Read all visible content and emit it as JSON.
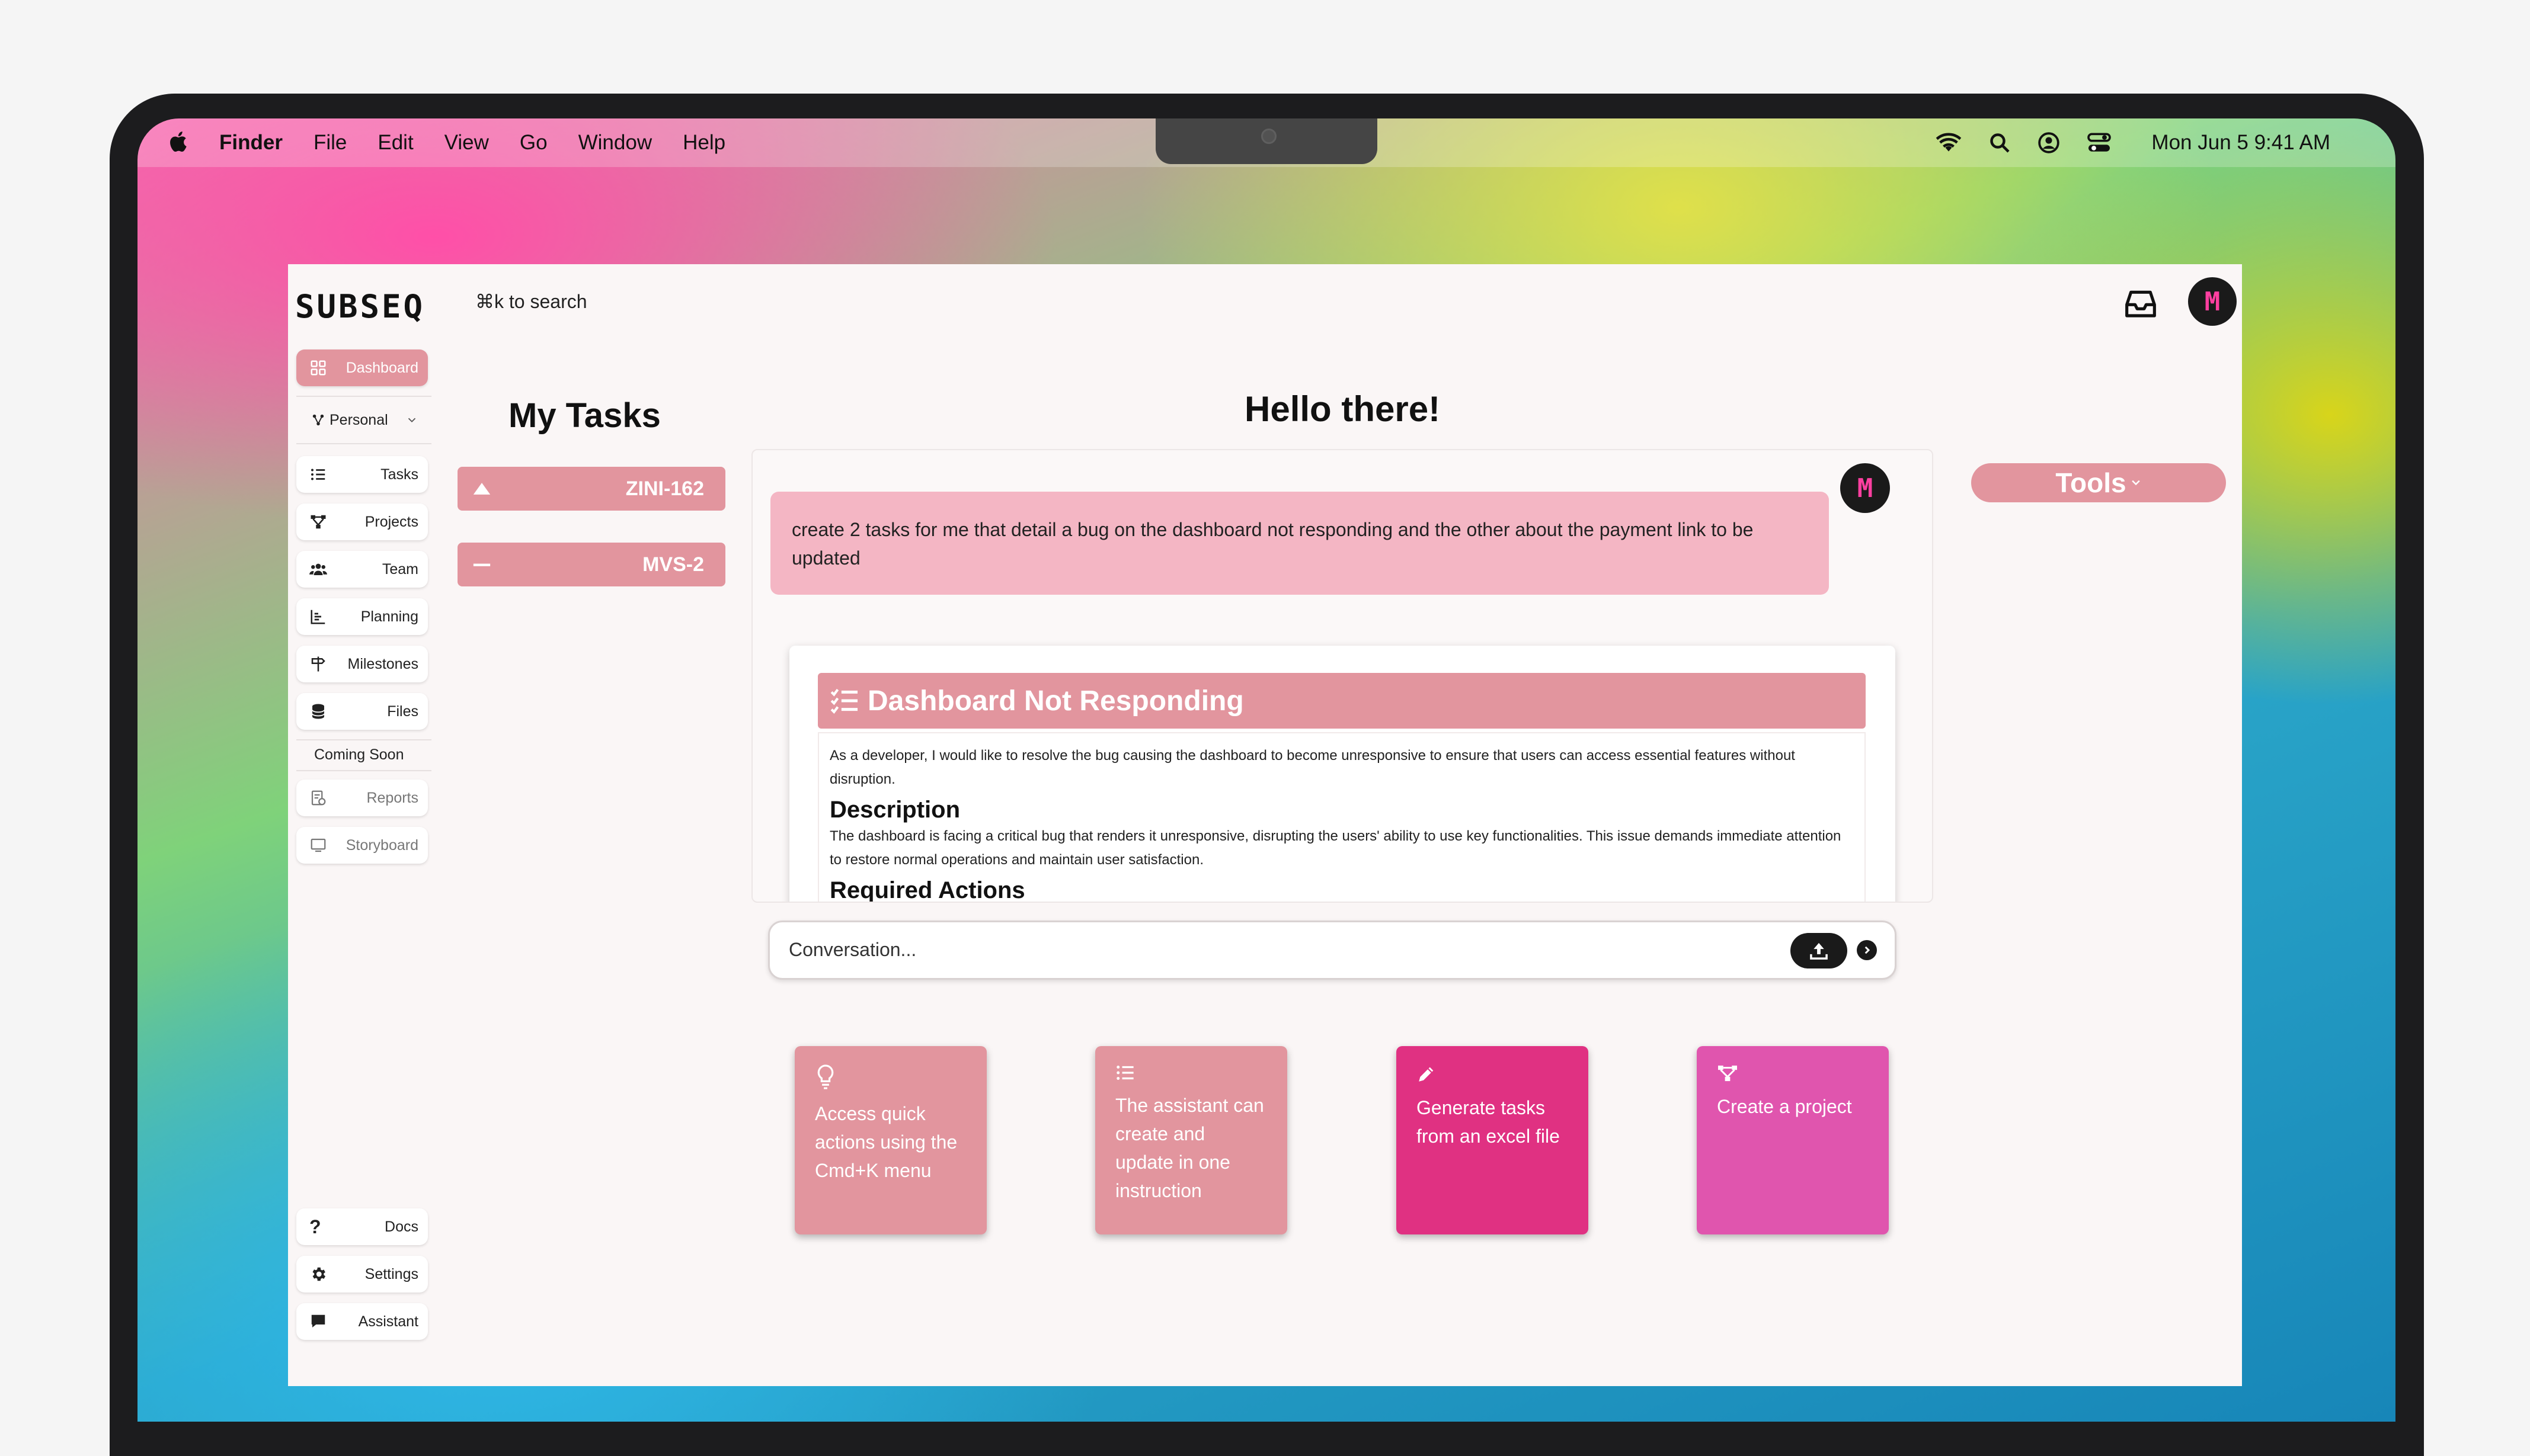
{
  "menubar": {
    "items": [
      "Finder",
      "File",
      "Edit",
      "View",
      "Go",
      "Window",
      "Help"
    ],
    "clock": "Mon Jun 5  9:41 AM",
    "icons": [
      "apple-icon",
      "wifi-icon",
      "search-icon",
      "user-icon",
      "control-center-icon"
    ]
  },
  "app": {
    "logo": "SUBSEQ",
    "search_hint": "⌘k to search",
    "avatar_letter": "M",
    "accent_color": "#e2959e",
    "sidebar": {
      "dashboard": "Dashboard",
      "workspace": "Personal",
      "items": [
        "Tasks",
        "Projects",
        "Team",
        "Planning",
        "Milestones",
        "Files"
      ],
      "coming_soon_label": "Coming Soon",
      "coming_soon_items": [
        "Reports",
        "Storyboard"
      ],
      "bottom_items": [
        "Docs",
        "Settings",
        "Assistant"
      ]
    },
    "my_tasks": {
      "title": "My Tasks",
      "tasks": [
        {
          "id": "ZINI-162",
          "priority": "high"
        },
        {
          "id": "MVS-2",
          "priority": "medium"
        }
      ]
    },
    "chat": {
      "greeting": "Hello there!",
      "user_message": "create 2 tasks for me that detail a bug on the dashboard not responding and the other about the payment link to be updated",
      "task_preview": {
        "title": "Dashboard Not Responding",
        "story": "As a developer, I would like to resolve the bug causing the dashboard to become unresponsive to ensure that users can access essential features without disruption.",
        "description_heading": "Description",
        "description": "The dashboard is facing a critical bug that renders it unresponsive, disrupting the users' ability to use key functionalities. This issue demands immediate attention to restore normal operations and maintain user satisfaction.",
        "actions_heading": "Required Actions"
      },
      "input_placeholder": "Conversation..."
    },
    "tools_label": "Tools",
    "quick_cards": [
      {
        "text": "Access quick actions using the Cmd+K menu",
        "icon": "lightbulb-icon",
        "color": "#e2959e"
      },
      {
        "text": "The assistant can create and update in one instruction",
        "icon": "list-icon",
        "color": "#e2959e"
      },
      {
        "text": "Generate tasks from an excel file",
        "icon": "pencil-icon",
        "color": "#e03182"
      },
      {
        "text": "Create a project",
        "icon": "project-icon",
        "color": "#e055ae"
      }
    ]
  }
}
